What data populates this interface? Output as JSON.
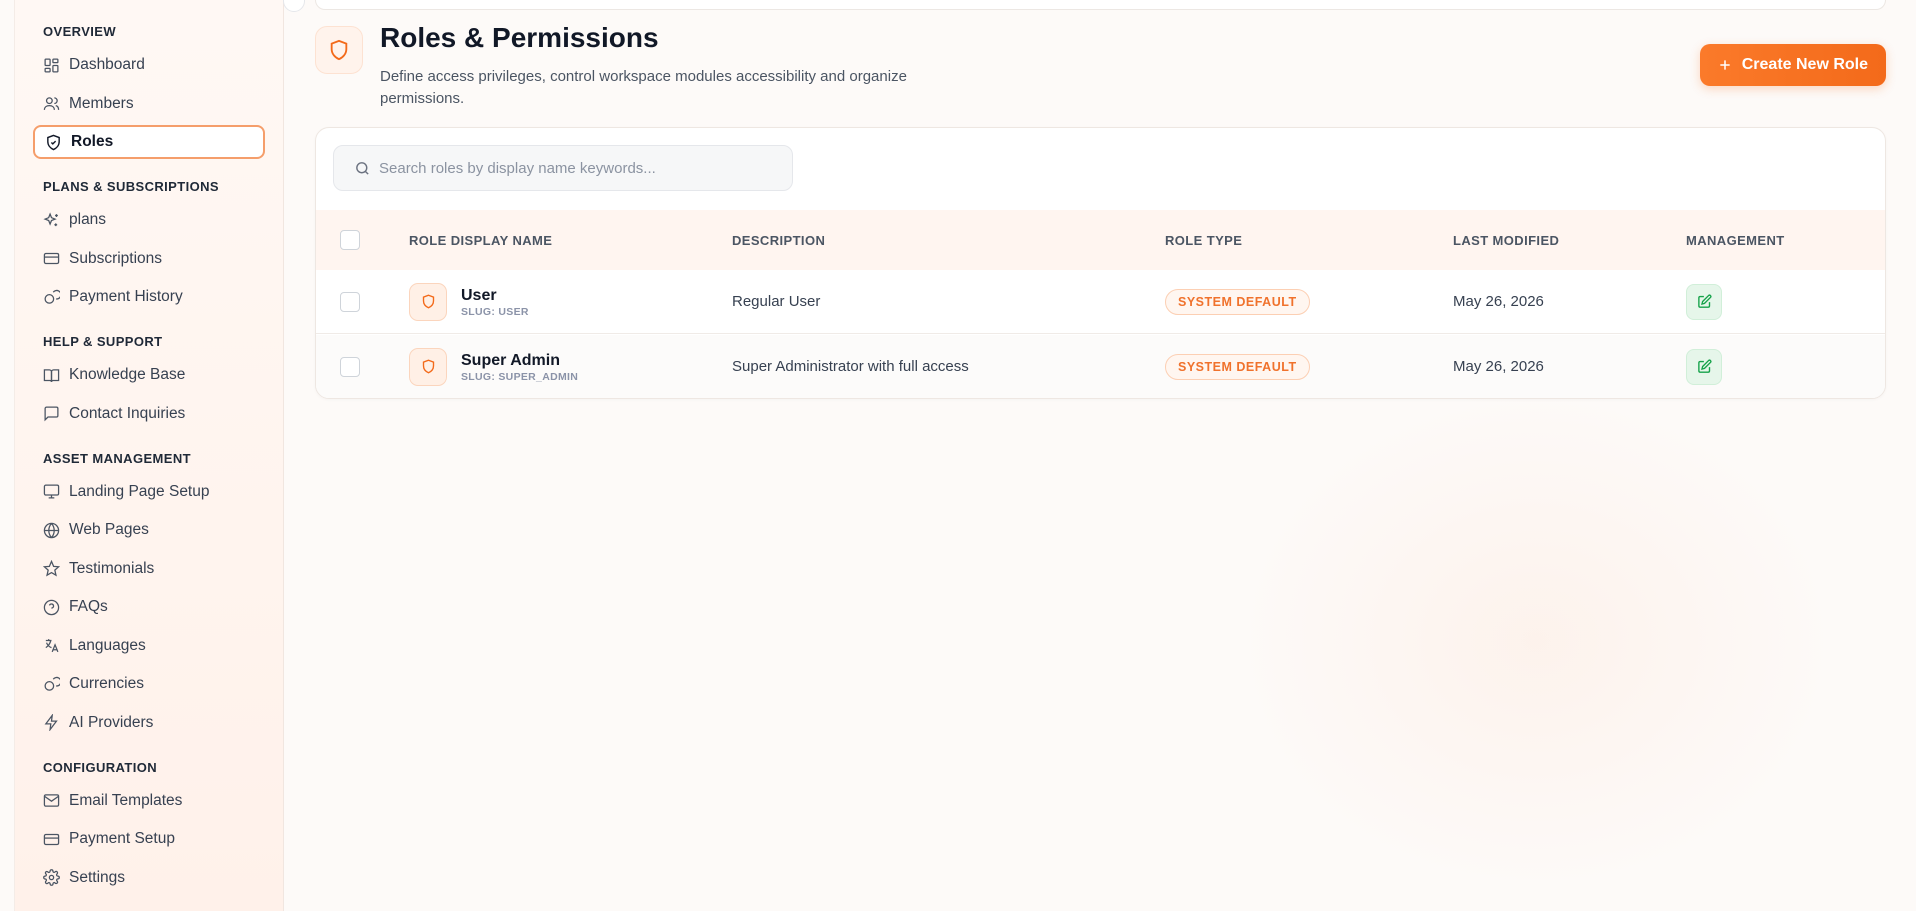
{
  "sidebar": {
    "sections": [
      {
        "title": "OVERVIEW",
        "items": [
          {
            "label": "Dashboard",
            "icon": "dashboard-icon"
          },
          {
            "label": "Members",
            "icon": "users-icon"
          },
          {
            "label": "Roles",
            "icon": "shield-check-icon",
            "active": true
          }
        ]
      },
      {
        "title": "PLANS & SUBSCRIPTIONS",
        "items": [
          {
            "label": "plans",
            "icon": "sparkles-icon"
          },
          {
            "label": "Subscriptions",
            "icon": "credit-card-icon"
          },
          {
            "label": "Payment History",
            "icon": "coins-icon"
          }
        ]
      },
      {
        "title": "HELP & SUPPORT",
        "items": [
          {
            "label": "Knowledge Base",
            "icon": "book-open-icon"
          },
          {
            "label": "Contact Inquiries",
            "icon": "message-square-icon"
          }
        ]
      },
      {
        "title": "ASSET MANAGEMENT",
        "items": [
          {
            "label": "Landing Page Setup",
            "icon": "monitor-icon"
          },
          {
            "label": "Web Pages",
            "icon": "globe-icon"
          },
          {
            "label": "Testimonials",
            "icon": "star-icon"
          },
          {
            "label": "FAQs",
            "icon": "help-circle-icon"
          },
          {
            "label": "Languages",
            "icon": "languages-icon"
          },
          {
            "label": "Currencies",
            "icon": "coins-icon"
          },
          {
            "label": "AI Providers",
            "icon": "zap-icon"
          }
        ]
      },
      {
        "title": "CONFIGURATION",
        "items": [
          {
            "label": "Email Templates",
            "icon": "mail-icon"
          },
          {
            "label": "Payment Setup",
            "icon": "credit-card-icon"
          },
          {
            "label": "Settings",
            "icon": "gear-icon"
          }
        ]
      }
    ]
  },
  "header": {
    "title": "Roles & Permissions",
    "subtitle": "Define access privileges, control workspace modules accessibility and organize permissions.",
    "create_button": "Create New Role"
  },
  "search": {
    "placeholder": "Search roles by display name keywords..."
  },
  "table": {
    "columns": {
      "name": "ROLE DISPLAY NAME",
      "description": "DESCRIPTION",
      "type": "ROLE TYPE",
      "modified": "LAST MODIFIED",
      "management": "MANAGEMENT"
    },
    "rows": [
      {
        "name": "User",
        "slug": "SLUG: USER",
        "description": "Regular User",
        "type": "SYSTEM DEFAULT",
        "modified": "May 26, 2026"
      },
      {
        "name": "Super Admin",
        "slug": "SLUG: SUPER_ADMIN",
        "description": "Super Administrator with full access",
        "type": "SYSTEM DEFAULT",
        "modified": "May 26, 2026"
      }
    ]
  },
  "colors": {
    "accent": "#f36a1a",
    "edit": "#16a34a"
  }
}
